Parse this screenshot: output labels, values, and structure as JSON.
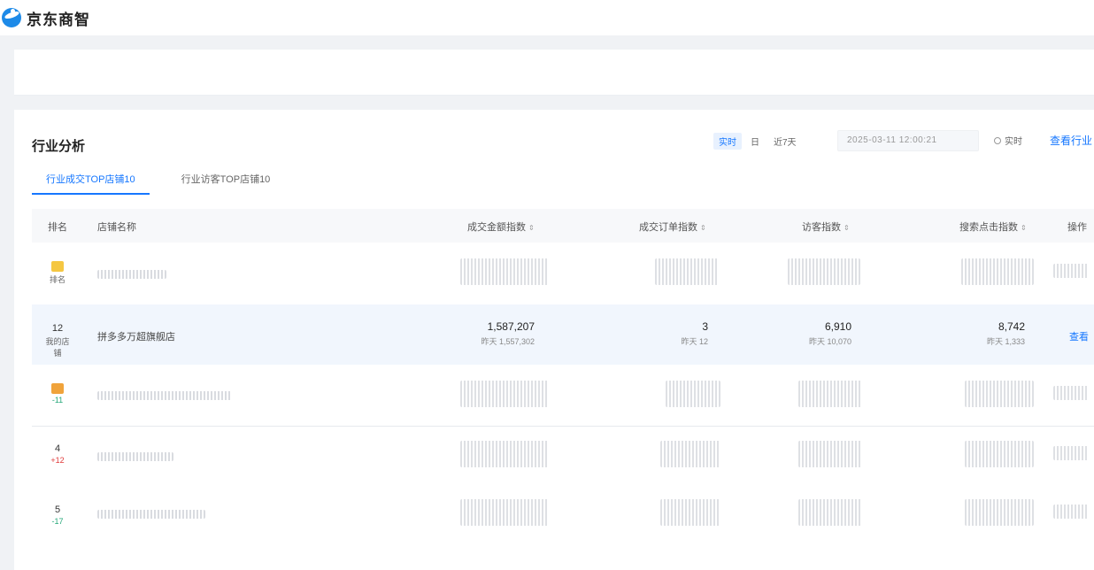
{
  "app": {
    "logo_text": "京东商智"
  },
  "panel": {
    "title": "行业分析",
    "segments": [
      "实时",
      "日",
      "近7天"
    ],
    "active_segment": 0,
    "date_value": "2025-03-11 12:00:21",
    "realtime_label": "实时",
    "view_more": "查看行业"
  },
  "tabs": [
    {
      "label": "行业成交TOP店铺10",
      "active": true
    },
    {
      "label": "行业访客TOP店铺10",
      "active": false
    }
  ],
  "table": {
    "headers": [
      "排名",
      "店铺名称",
      "成交金额指数",
      "成交订单指数",
      "访客指数",
      "搜索点击指数",
      "操作"
    ],
    "rows": [
      {
        "rank": "",
        "medal": "gold",
        "change": "排名",
        "change_dir": "neutral",
        "shop": "",
        "blurred": true
      },
      {
        "rank": "12",
        "medal": "",
        "change": "我的店铺",
        "change_dir": "neutral",
        "shop": "拼多多万超旗舰店",
        "blurred": false,
        "amount": "1,587,207",
        "amount_sub": "昨天 1,557,302",
        "orders": "3",
        "orders_sub": "昨天 12",
        "visitors": "6,910",
        "visitors_sub": "昨天 10,070",
        "search": "8,742",
        "search_sub": "昨天 1,333",
        "op": "查看"
      },
      {
        "rank": "",
        "medal": "orange",
        "change": "-11",
        "change_dir": "down",
        "shop": "",
        "blurred": true
      },
      {
        "rank": "4",
        "medal": "",
        "change": "+12",
        "change_dir": "up",
        "shop": "",
        "blurred": true
      },
      {
        "rank": "5",
        "medal": "",
        "change": "-17",
        "change_dir": "down",
        "shop": "",
        "blurred": true
      }
    ]
  },
  "colors": {
    "accent": "#1677ff",
    "up": "#e03b3b",
    "down": "#27a87a",
    "gold": "#f5c742",
    "orange": "#f0a33b"
  },
  "icons": [
    "logo-icon",
    "radio-icon",
    "sort-icon"
  ]
}
